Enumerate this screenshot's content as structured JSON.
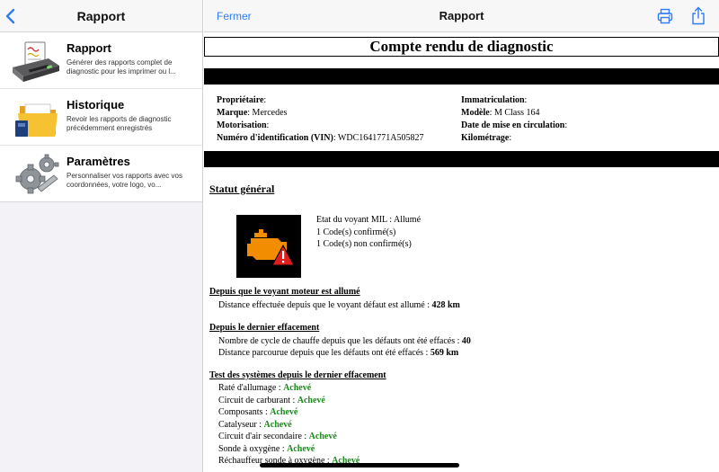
{
  "sidebar": {
    "title": "Rapport",
    "items": [
      {
        "title": "Rapport",
        "description": "Générer des rapports complet de diagnostic pour les imprimer ou l...",
        "icon": "printer-report-icon"
      },
      {
        "title": "Historique",
        "description": "Revoir les rapports de diagnostic précédemment enregistrés",
        "icon": "folder-icon"
      },
      {
        "title": "Paramètres",
        "description": "Personnaliser vos rapports avec vos coordonnées, votre logo, vo...",
        "icon": "gears-icon"
      }
    ]
  },
  "detail": {
    "close_label": "Fermer",
    "title": "Rapport"
  },
  "report": {
    "header": "Compte rendu de diagnostic",
    "vehicle": {
      "owner_label": "Propriétaire",
      "brand_label": "Marque",
      "brand_value": "Mercedes",
      "engine_label": "Motorisation",
      "vin_label": "Numéro d'identification (VIN)",
      "vin_value": "WDC1641771A505827",
      "plate_label": "Immatriculation",
      "model_label": "Modèle",
      "model_value": "M Class 164",
      "registration_date_label": "Date de mise en circulation",
      "mileage_label": "Kilométrage"
    },
    "status": {
      "title": "Statut général",
      "mil_state": "Etat du voyant MIL : Allumé",
      "confirmed": "1 Code(s) confirmé(s)",
      "unconfirmed": "1 Code(s) non confirmé(s)",
      "mil_color": "#f28c00",
      "warning_color": "#e01e1e"
    },
    "since_mil": {
      "title": "Depuis que le voyant moteur est allumé",
      "distance_label": "Distance effectuée depuis que le voyant défaut est allumé :",
      "distance_value": "428 km"
    },
    "since_clear": {
      "title": "Depuis le dernier effacement",
      "cycles_label": "Nombre de cycle de chauffe depuis que les défauts ont été effacés :",
      "cycles_value": "40",
      "distance_label": "Distance parcourue depuis que les défauts ont été effacés :",
      "distance_value": "569 km"
    },
    "tests": {
      "title": "Test des systèmes depuis le dernier effacement",
      "items": [
        {
          "label": "Raté d'allumage :",
          "value": "Achevé"
        },
        {
          "label": "Circuit de carburant :",
          "value": "Achevé"
        },
        {
          "label": "Composants :",
          "value": "Achevé"
        },
        {
          "label": "Catalyseur :",
          "value": "Achevé"
        },
        {
          "label": "Circuit d'air secondaire :",
          "value": "Achevé"
        },
        {
          "label": "Sonde à oxygène :",
          "value": "Achevé"
        },
        {
          "label": "Réchauffeur sonde à oxygène :",
          "value": "Achevé"
        }
      ]
    }
  },
  "colors": {
    "accent": "#2f7cf6",
    "status_ok": "#1a8a1a"
  }
}
